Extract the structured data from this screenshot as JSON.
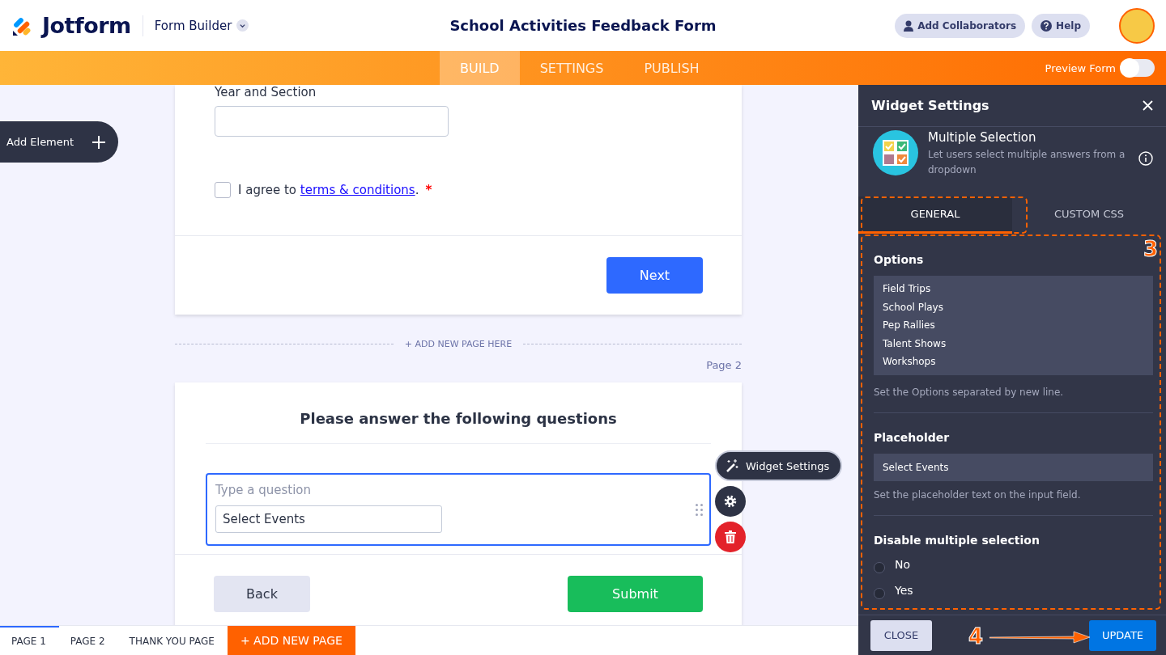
{
  "header": {
    "brand": "Jotform",
    "app_menu": "Form Builder",
    "title": "School Activities Feedback Form",
    "buttons": [
      {
        "kind": "collaborators",
        "label": "Add Collaborators"
      },
      {
        "kind": "help",
        "label": "Help"
      }
    ]
  },
  "nav": {
    "tabs": [
      {
        "label": "BUILD",
        "selected": true
      },
      {
        "label": "SETTINGS",
        "selected": false
      },
      {
        "label": "PUBLISH",
        "selected": false
      }
    ],
    "preview": {
      "label": "Preview Form",
      "on": false
    }
  },
  "add_element": {
    "label": "Add Element"
  },
  "page1": {
    "field_label": "Year and Section",
    "agree": {
      "checked": false,
      "before": "I agree to ",
      "link": "terms & conditions",
      "after": ".",
      "required_mark": "*"
    },
    "next_button": "Next"
  },
  "add_page_divider": "+ ADD NEW PAGE HERE",
  "page_label": "Page 2",
  "page2": {
    "heading": "Please answer the following questions",
    "question": {
      "placeholder": "Type a question",
      "select_value": "Select Events"
    },
    "back_button": "Back",
    "submit_button": "Submit"
  },
  "field_toolbar": {
    "widget_settings": "Widget Settings"
  },
  "page_tabs": [
    {
      "label": "PAGE 1",
      "selected": true
    },
    {
      "label": "PAGE 2",
      "selected": false
    },
    {
      "label": "THANK YOU PAGE",
      "selected": false
    }
  ],
  "add_new_page": "+ ADD NEW PAGE",
  "panel": {
    "title": "Widget Settings",
    "widget": {
      "name": "Multiple Selection",
      "description": "Let users select multiple answers from a dropdown"
    },
    "tabs": [
      {
        "label": "GENERAL",
        "selected": true
      },
      {
        "label": "CUSTOM CSS",
        "selected": false
      }
    ],
    "options": {
      "label": "Options",
      "items": [
        "Field Trips",
        "School Plays",
        "Pep Rallies",
        "Talent Shows",
        "Workshops"
      ],
      "hint": "Set the Options separated by new line."
    },
    "placeholder": {
      "label": "Placeholder",
      "value": "Select Events",
      "hint": "Set the placeholder text on the input field."
    },
    "disable_multiple": {
      "label": "Disable multiple selection",
      "choices": [
        {
          "label": "No",
          "selected": false
        },
        {
          "label": "Yes",
          "selected": false
        }
      ]
    },
    "close_button": "CLOSE",
    "update_button": "UPDATE"
  },
  "annotations": [
    {
      "label": "3"
    },
    {
      "label": "4"
    }
  ]
}
